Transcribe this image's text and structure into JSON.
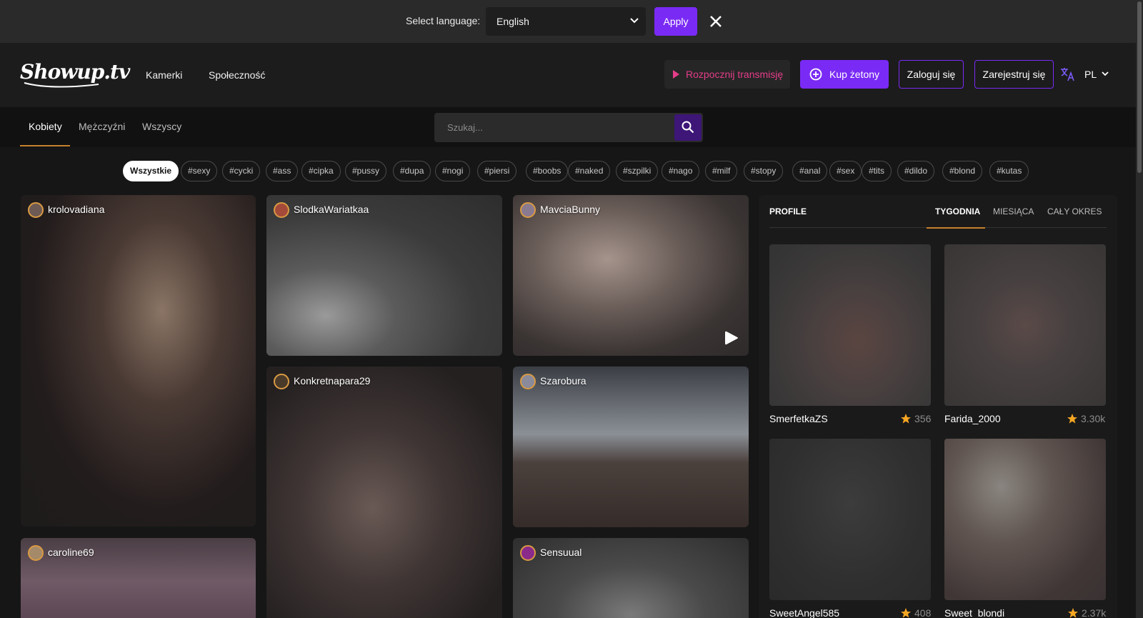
{
  "language_bar": {
    "label": "Select language:",
    "selected": "English",
    "apply_label": "Apply"
  },
  "header": {
    "logo_text": "Showup.tv",
    "nav": [
      "Kamerki",
      "Społeczność"
    ],
    "stream_label": "Rozpocznij transmisję",
    "buy_label": "Kup żetony",
    "login_label": "Zaloguj się",
    "register_label": "Zarejestruj się",
    "lang_code": "PL"
  },
  "categories": {
    "items": [
      "Kobiety",
      "Mężczyźni",
      "Wszyscy"
    ],
    "active": "Kobiety"
  },
  "search": {
    "placeholder": "Szukaj..."
  },
  "tags": [
    "Wszystkie",
    "#sexy",
    "#cycki",
    "#ass",
    "#cipka",
    "#pussy",
    "#dupa",
    "#nogi",
    "#piersi",
    "#boobs",
    "#naked",
    "#szpilki",
    "#nago",
    "#milf",
    "#stopy",
    "#anal",
    "#sex",
    "#tits",
    "#dildo",
    "#blond",
    "#kutas"
  ],
  "streams": [
    {
      "name": "krolovadiana"
    },
    {
      "name": "SlodkaWariatkaa"
    },
    {
      "name": "MavciaBunny"
    },
    {
      "name": "Konkretnapara29"
    },
    {
      "name": "Szarobura"
    },
    {
      "name": "caroline69"
    },
    {
      "name": "Sensuual"
    }
  ],
  "profile_panel": {
    "title": "PROFILE",
    "tabs": [
      "TYGODNIA",
      "MIESIĄCA",
      "CAŁY OKRES"
    ],
    "active_tab": "TYGODNIA",
    "profiles": [
      {
        "name": "SmerfetkaZS",
        "score": "356"
      },
      {
        "name": "Farida_2000",
        "score": "3.30k"
      },
      {
        "name": "SweetAngel585",
        "score": "408"
      },
      {
        "name": "Sweet_blondi",
        "score": "2.37k"
      }
    ]
  },
  "colors": {
    "accent_purple": "#7a2af5",
    "accent_pink": "#e53d8a",
    "accent_gold": "#c5812d",
    "star": "#f5a623"
  }
}
